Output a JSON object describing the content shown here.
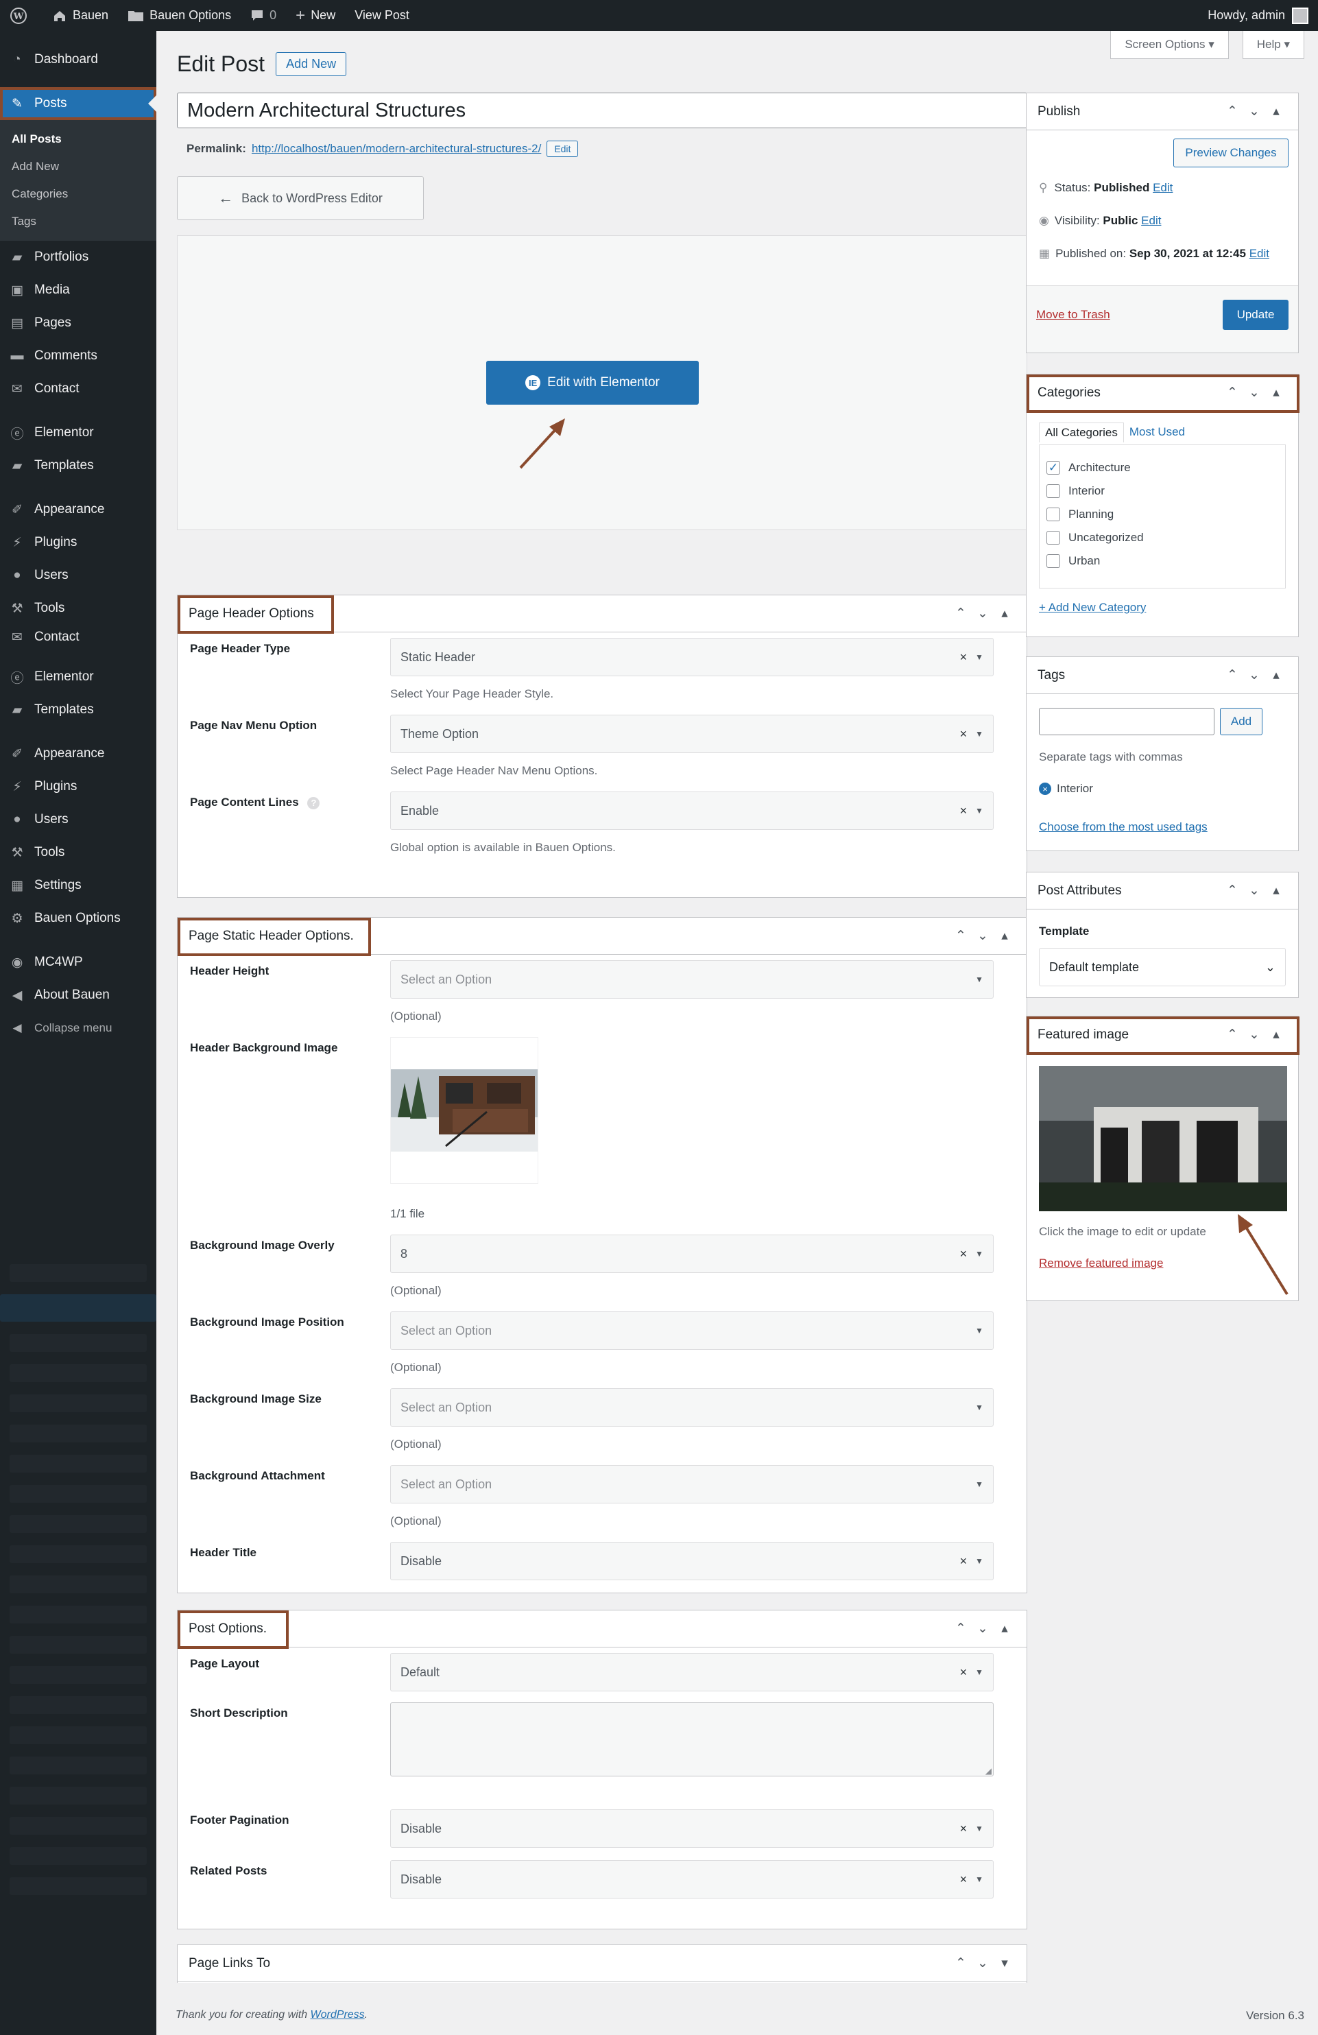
{
  "adminbar": {
    "site_name": "Bauen",
    "theme_options": "Bauen Options",
    "comments_count": "0",
    "new_label": "New",
    "view_post": "View Post",
    "howdy": "Howdy, admin"
  },
  "sidebar": {
    "items": [
      {
        "label": "Dashboard",
        "icon": "dashboard-icon"
      },
      {
        "label": "Posts",
        "icon": "pin-icon"
      },
      {
        "label": "Portfolios",
        "icon": "folder-icon"
      },
      {
        "label": "Media",
        "icon": "media-icon"
      },
      {
        "label": "Pages",
        "icon": "page-icon"
      },
      {
        "label": "Comments",
        "icon": "comment-icon"
      },
      {
        "label": "Contact",
        "icon": "mail-icon"
      },
      {
        "label": "Elementor",
        "icon": "elementor-icon"
      },
      {
        "label": "Templates",
        "icon": "folder-icon"
      },
      {
        "label": "Appearance",
        "icon": "brush-icon"
      },
      {
        "label": "Plugins",
        "icon": "plugin-icon"
      },
      {
        "label": "Users",
        "icon": "user-icon"
      },
      {
        "label": "Tools",
        "icon": "wrench-icon"
      },
      {
        "label": "Contact",
        "icon": "mail-icon"
      },
      {
        "label": "Elementor",
        "icon": "elementor-icon"
      },
      {
        "label": "Templates",
        "icon": "folder-icon"
      },
      {
        "label": "Appearance",
        "icon": "brush-icon"
      },
      {
        "label": "Plugins",
        "icon": "plugin-icon"
      },
      {
        "label": "Users",
        "icon": "user-icon"
      },
      {
        "label": "Tools",
        "icon": "wrench-icon"
      },
      {
        "label": "Settings",
        "icon": "settings-icon"
      },
      {
        "label": "Bauen Options",
        "icon": "gear-icon"
      },
      {
        "label": "MC4WP",
        "icon": "mc4wp-icon"
      },
      {
        "label": "About Bauen",
        "icon": "megaphone-icon"
      },
      {
        "label": "Collapse menu",
        "icon": "collapse-icon"
      }
    ],
    "posts_sub": [
      "All Posts",
      "Add New",
      "Categories",
      "Tags"
    ]
  },
  "screen_meta": {
    "screen_options": "Screen Options",
    "help": "Help"
  },
  "header": {
    "title": "Edit Post",
    "add_new": "Add New"
  },
  "post": {
    "title": "Modern Architectural Structures",
    "permalink_label": "Permalink:",
    "permalink_url": "http://localhost/bauen/modern-architectural-structures-2/",
    "permalink_edit": "Edit",
    "back_editor": "Back to WordPress Editor",
    "edit_elementor": "Edit with Elementor"
  },
  "page_header_options": {
    "title": "Page Header Options",
    "rows": [
      {
        "label": "Page Header Type",
        "value": "Static Header",
        "help": "Select Your Page Header Style."
      },
      {
        "label": "Page Nav Menu Option",
        "value": "Theme Option",
        "help": "Select Page Header Nav Menu Options."
      },
      {
        "label": "Page Content Lines",
        "value": "Enable",
        "help": "Global option is available in Bauen Options."
      }
    ]
  },
  "static_header": {
    "title": "Page Static Header Options.",
    "header_height": {
      "label": "Header Height",
      "placeholder": "Select an Option",
      "help": "(Optional)"
    },
    "bg_image": {
      "label": "Header Background Image",
      "count": "1/1 file"
    },
    "bg_overlay": {
      "label": "Background Image Overly",
      "value": "8",
      "help": "(Optional)"
    },
    "bg_position": {
      "label": "Background Image Position",
      "placeholder": "Select an Option",
      "help": "(Optional)"
    },
    "bg_size": {
      "label": "Background Image Size",
      "placeholder": "Select an Option",
      "help": "(Optional)"
    },
    "bg_attachment": {
      "label": "Background Attachment",
      "placeholder": "Select an Option",
      "help": "(Optional)"
    },
    "header_title": {
      "label": "Header Title",
      "value": "Disable"
    }
  },
  "post_options": {
    "title": "Post Options.",
    "page_layout": {
      "label": "Page Layout",
      "value": "Default"
    },
    "short_description": {
      "label": "Short Description"
    },
    "footer_pagination": {
      "label": "Footer Pagination",
      "value": "Disable"
    },
    "related_posts": {
      "label": "Related Posts",
      "value": "Disable"
    }
  },
  "page_links": {
    "title": "Page Links To"
  },
  "publish": {
    "title": "Publish",
    "preview": "Preview Changes",
    "status_label": "Status:",
    "status_value": "Published",
    "visibility_label": "Visibility:",
    "visibility_value": "Public",
    "published_label": "Published on:",
    "published_value": "Sep 30, 2021 at 12:45",
    "edit": "Edit",
    "trash": "Move to Trash",
    "update": "Update"
  },
  "categories": {
    "title": "Categories",
    "tab_all": "All Categories",
    "tab_most": "Most Used",
    "items": [
      {
        "label": "Architecture",
        "checked": true
      },
      {
        "label": "Interior",
        "checked": false
      },
      {
        "label": "Planning",
        "checked": false
      },
      {
        "label": "Uncategorized",
        "checked": false
      },
      {
        "label": "Urban",
        "checked": false
      }
    ],
    "add_new": "+ Add New Category"
  },
  "tags": {
    "title": "Tags",
    "add": "Add",
    "hint": "Separate tags with commas",
    "tag": "Interior",
    "choose": "Choose from the most used tags"
  },
  "attributes": {
    "title": "Post Attributes",
    "template_label": "Template",
    "template_value": "Default template"
  },
  "featured": {
    "title": "Featured image",
    "hint": "Click the image to edit or update",
    "remove": "Remove featured image"
  },
  "footer": {
    "thanks_prefix": "Thank you for creating with ",
    "wp_link": "WordPress",
    "thanks_suffix": ".",
    "version": "Version 6.3"
  },
  "colors": {
    "accent": "#2271b1",
    "highlight": "#8a4a2d",
    "sidebar": "#1d2327"
  }
}
